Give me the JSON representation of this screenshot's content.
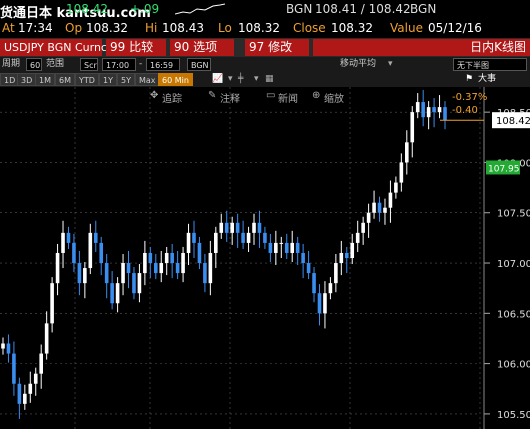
{
  "header": {
    "watermark": "货通日本 kantsuu.com",
    "last_price_partial": "108.42",
    "change": "+.09",
    "source": "BGN",
    "bid_ask": "108.41 / 108.42",
    "source2": "BGN"
  },
  "quote_line": {
    "at_label": "At",
    "at_value": "17:34",
    "op_label": "Op",
    "op_value": "108.32",
    "hi_label": "Hi",
    "hi_value": "108.43",
    "lo_label": "Lo",
    "lo_value": "108.32",
    "close_label": "Close",
    "close_value": "108.32",
    "value_label": "Value",
    "value_value": "05/12/16"
  },
  "title_bar": {
    "security": "USDJPY BGN Curncy",
    "btn_compare": "99 比较",
    "btn_options": "90 选项",
    "btn_edit": "97 修改",
    "chart_name": "日内K线图"
  },
  "controls": {
    "period_label": "周期",
    "period_value": "60",
    "range_label": "范围",
    "range_type": "Scr",
    "time_from": "17:00",
    "time_to": "16:59",
    "source": "BGN",
    "moving_avg": "移动平均",
    "half_screen": "无下半图"
  },
  "timebar": {
    "buttons": [
      "1D",
      "3D",
      "1M",
      "6M",
      "YTD",
      "1Y",
      "5Y",
      "Max"
    ],
    "selected": "60 Min",
    "events": "大事"
  },
  "toolbar": {
    "track": "追踪",
    "annotate": "注释",
    "news": "新闻",
    "zoom": "缩放"
  },
  "colors": {
    "accent": "#f0a030",
    "up": "#ffffff",
    "down": "#3a8ef0",
    "bg": "#000000",
    "grid": "#555555",
    "last_label": "#2fe070"
  },
  "chart_data": {
    "type": "candlestick",
    "yaxis_ticks": [
      "108.50",
      "108.00",
      "107.50",
      "107.00",
      "106.50",
      "106.00",
      "105.50"
    ],
    "ylim": [
      105.35,
      108.75
    ],
    "annotations": [
      {
        "text": "-0.37%",
        "y": 108.66
      },
      {
        "text": "-0.40",
        "y": 108.53
      }
    ],
    "last_price_label": "108.42",
    "last_price": 108.42,
    "secondary_label": "107.95",
    "secondary_value": 107.95,
    "closes": [
      106.2,
      106.1,
      105.8,
      105.6,
      105.7,
      105.8,
      105.9,
      106.1,
      106.4,
      106.8,
      107.1,
      107.3,
      107.2,
      107.0,
      106.8,
      106.95,
      107.3,
      107.2,
      107.0,
      106.8,
      106.6,
      106.8,
      107.0,
      106.9,
      106.7,
      106.9,
      107.1,
      107.0,
      106.9,
      107.0,
      107.1,
      107.0,
      106.9,
      107.1,
      107.3,
      107.2,
      107.0,
      106.8,
      107.1,
      107.3,
      107.4,
      107.3,
      107.4,
      107.3,
      107.2,
      107.3,
      107.4,
      107.3,
      107.2,
      107.1,
      107.2,
      107.2,
      107.1,
      107.2,
      107.1,
      107.0,
      106.9,
      106.7,
      106.5,
      106.7,
      106.8,
      107.0,
      107.1,
      107.05,
      107.2,
      107.3,
      107.4,
      107.5,
      107.6,
      107.5,
      107.55,
      107.7,
      107.8,
      108.0,
      108.2,
      108.5,
      108.6,
      108.45,
      108.55,
      108.5,
      108.55,
      108.42
    ]
  }
}
